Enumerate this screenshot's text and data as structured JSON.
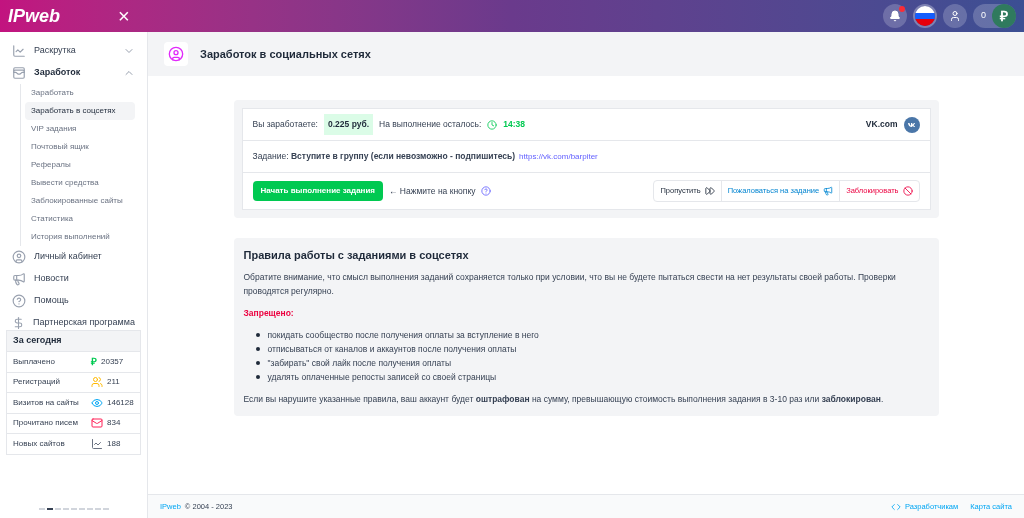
{
  "header": {
    "logo": "IPweb",
    "close": "×",
    "balance": "0",
    "currency": "₽",
    "notification": true
  },
  "sidebar": {
    "items": [
      {
        "label": "Раскрутка",
        "expanded": false
      },
      {
        "label": "Заработок",
        "expanded": true,
        "children": [
          {
            "label": "Заработать",
            "selected": false
          },
          {
            "label": "Заработать в соцсетях",
            "selected": true
          },
          {
            "label": "VIP задания",
            "selected": false
          },
          {
            "label": "Почтовый ящик",
            "selected": false
          },
          {
            "label": "Рефералы",
            "selected": false
          },
          {
            "label": "Вывести средства",
            "selected": false
          },
          {
            "label": "Заблокированные сайты",
            "selected": false
          },
          {
            "label": "Статистика",
            "selected": false
          },
          {
            "label": "История выполнений",
            "selected": false
          }
        ]
      },
      {
        "label": "Личный кабинет"
      },
      {
        "label": "Новости"
      },
      {
        "label": "Помощь"
      },
      {
        "label": "Партнерская программа"
      }
    ]
  },
  "today": {
    "title": "За сегодня",
    "rows": [
      {
        "label": "Выплачено",
        "symbol": "₽",
        "value": "20357"
      },
      {
        "label": "Регистраций",
        "value": "211"
      },
      {
        "label": "Визитов на сайты",
        "value": "146128"
      },
      {
        "label": "Прочитано писем",
        "value": "834"
      },
      {
        "label": "Новых сайтов",
        "value": "188"
      }
    ]
  },
  "pager": [
    {
      "selected": false
    },
    {
      "selected": true
    },
    {
      "selected": false
    },
    {
      "selected": false
    },
    {
      "selected": false
    },
    {
      "selected": false
    },
    {
      "selected": false
    },
    {
      "selected": false
    },
    {
      "selected": false
    }
  ],
  "page_title": "Заработок в социальных сетях",
  "task": {
    "earn_label": "Вы заработаете:",
    "earn_value": "0.225 руб.",
    "time_label": "На выполнение осталось:",
    "time_value": "14:38",
    "network": "VK.com",
    "task_text": "Задание: **Вступите в группу (если невозможно - подпишитесь)**",
    "link": "https://vk.com/barpiter",
    "start_button": "Начать выполнение задания",
    "hint": "← Нажмите на кнопку",
    "actions": [
      {
        "label": "Пропустить",
        "kind": "skip"
      },
      {
        "label": "Пожаловаться на задание",
        "kind": "report"
      },
      {
        "label": "Заблокировать",
        "kind": "block"
      }
    ]
  },
  "rules": {
    "title": "Правила работы с заданиями в соцсетях",
    "intro": "Обратите внимание, что смысл выполнения заданий сохраняется только при условии, что вы не будете пытаться свести на нет результаты своей работы. Проверки проводятся регулярно.",
    "forbidden_label": "Запрещено:",
    "items": [
      "покидать сообщество после получения оплаты за вступление в него",
      "отписываться от каналов и аккаунтов после получения оплаты",
      "\"забирать\" свой лайк после получения оплаты",
      "удалять оплаченные репосты записей со своей страницы"
    ],
    "warning": "Если вы нарушите указанные правила, ваш аккаунт будет **оштрафован** на сумму, превышающую стоимость выполнения задания в 3-10 раз или **заблокирован**."
  },
  "footer": {
    "brand": "IPweb",
    "copyright": "© 2004 - 2023",
    "links": [
      "Разработчикам",
      "Карта сайта"
    ]
  }
}
